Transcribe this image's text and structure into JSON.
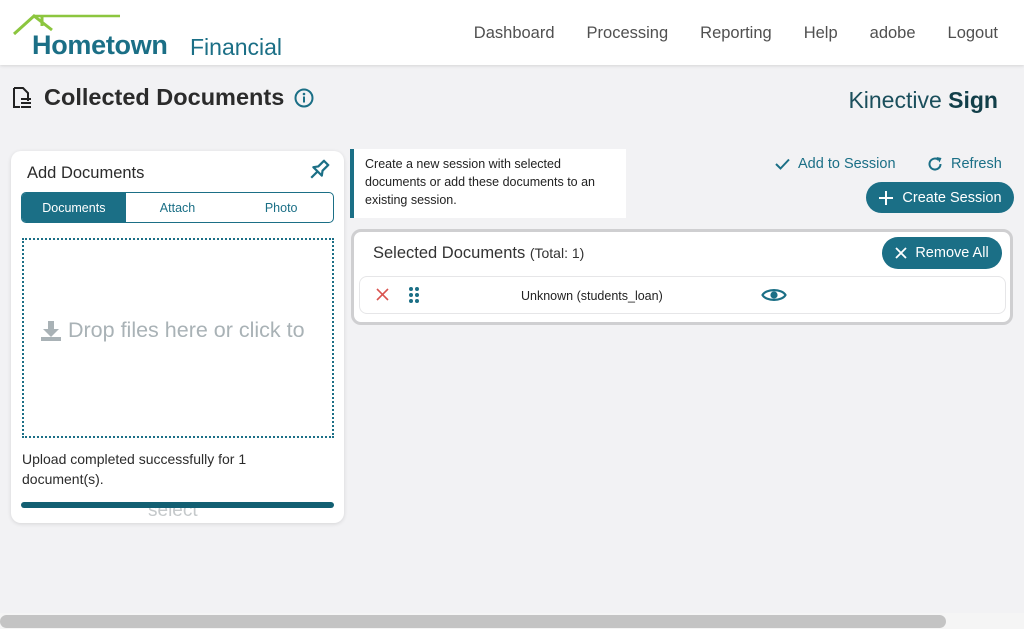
{
  "header": {
    "logo_main": "Hometown",
    "logo_sub": "Financial",
    "nav": [
      "Dashboard",
      "Processing",
      "Reporting",
      "Help",
      "adobe",
      "Logout"
    ]
  },
  "page": {
    "title": "Collected Documents",
    "brand_light": "Kinective",
    "brand_bold": "Sign"
  },
  "add_documents": {
    "title": "Add Documents",
    "tabs": [
      "Documents",
      "Attach",
      "Photo"
    ],
    "active_tab": "Documents",
    "drop_text": "Drop files here or click to",
    "drop_text_overflow": "select",
    "upload_message": "Upload completed successfully for 1 document(s).",
    "progress": 1.0
  },
  "note": {
    "text": "Create a new session with selected documents or add these documents to an existing session."
  },
  "actions": {
    "add_to_session": "Add to Session",
    "refresh": "Refresh",
    "create_session": "Create Session",
    "remove_all": "Remove All"
  },
  "selected_documents": {
    "title": "Selected Documents",
    "total_label": "(Total: 1)",
    "rows": [
      {
        "name": "Unknown (students_loan)"
      }
    ]
  },
  "colors": {
    "accent": "#1b6f86",
    "logo_green": "#8cc63f",
    "remove_red": "#d9534f"
  },
  "icons": [
    "document-icon",
    "info-icon",
    "pin-icon",
    "download-icon",
    "check-icon",
    "refresh-icon",
    "plus-icon",
    "close-icon",
    "drag-handle-icon",
    "eye-icon"
  ]
}
